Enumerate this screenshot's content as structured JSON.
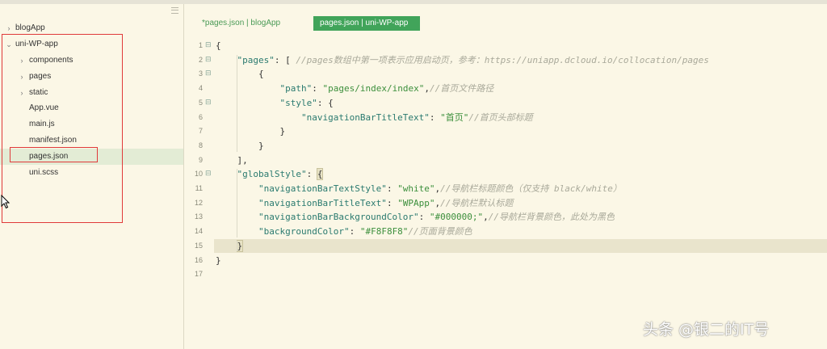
{
  "sidebar": {
    "items": [
      {
        "label": "blogApp",
        "arrow": "›"
      },
      {
        "label": "uni-WP-app",
        "arrow": "⌄"
      },
      {
        "label": "components",
        "arrow": "›"
      },
      {
        "label": "pages",
        "arrow": "›"
      },
      {
        "label": "static",
        "arrow": "›"
      },
      {
        "label": "App.vue",
        "arrow": ""
      },
      {
        "label": "main.js",
        "arrow": ""
      },
      {
        "label": "manifest.json",
        "arrow": ""
      },
      {
        "label": "pages.json",
        "arrow": ""
      },
      {
        "label": "uni.scss",
        "arrow": ""
      }
    ]
  },
  "tabs": [
    {
      "label": "*pages.json | blogApp"
    },
    {
      "label": "pages.json | uni-WP-app"
    }
  ],
  "editor": {
    "line_numbers": [
      "1",
      "2",
      "3",
      "4",
      "5",
      "6",
      "7",
      "8",
      "9",
      "10",
      "11",
      "12",
      "13",
      "14",
      "15",
      "16",
      "17"
    ],
    "folds": [
      "⊟",
      "⊟",
      "⊟",
      "",
      "⊟",
      "",
      "",
      "",
      "",
      "⊟",
      "",
      "",
      "",
      "",
      "",
      "",
      ""
    ],
    "lines": [
      [
        {
          "t": "p",
          "v": "{"
        }
      ],
      [
        {
          "t": "p",
          "v": "    "
        },
        {
          "t": "k",
          "v": "\"pages\""
        },
        {
          "t": "p",
          "v": ": [ "
        },
        {
          "t": "c",
          "v": "//pages数组中第一项表示应用启动页，参考：https://uniapp.dcloud.io/collocation/pages"
        }
      ],
      [
        {
          "t": "p",
          "v": "        {"
        }
      ],
      [
        {
          "t": "p",
          "v": "            "
        },
        {
          "t": "k",
          "v": "\"path\""
        },
        {
          "t": "p",
          "v": ": "
        },
        {
          "t": "s",
          "v": "\"pages/index/index\""
        },
        {
          "t": "p",
          "v": ","
        },
        {
          "t": "c",
          "v": "//首页文件路径"
        }
      ],
      [
        {
          "t": "p",
          "v": "            "
        },
        {
          "t": "k",
          "v": "\"style\""
        },
        {
          "t": "p",
          "v": ": {"
        }
      ],
      [
        {
          "t": "p",
          "v": "                "
        },
        {
          "t": "k",
          "v": "\"navigationBarTitleText\""
        },
        {
          "t": "p",
          "v": ": "
        },
        {
          "t": "s",
          "v": "\"首页\""
        },
        {
          "t": "c",
          "v": "//首页头部标题"
        }
      ],
      [
        {
          "t": "p",
          "v": "            }"
        }
      ],
      [
        {
          "t": "p",
          "v": "        }"
        }
      ],
      [
        {
          "t": "p",
          "v": "    ],"
        }
      ],
      [
        {
          "t": "p",
          "v": "    "
        },
        {
          "t": "k",
          "v": "\"globalStyle\""
        },
        {
          "t": "p",
          "v": ": "
        },
        {
          "t": "b",
          "v": "{"
        }
      ],
      [
        {
          "t": "p",
          "v": "        "
        },
        {
          "t": "k",
          "v": "\"navigationBarTextStyle\""
        },
        {
          "t": "p",
          "v": ": "
        },
        {
          "t": "s",
          "v": "\"white\""
        },
        {
          "t": "p",
          "v": ","
        },
        {
          "t": "c",
          "v": "//导航栏标题颜色（仅支持 black/white）"
        }
      ],
      [
        {
          "t": "p",
          "v": "        "
        },
        {
          "t": "k",
          "v": "\"navigationBarTitleText\""
        },
        {
          "t": "p",
          "v": ": "
        },
        {
          "t": "s",
          "v": "\"WPApp\""
        },
        {
          "t": "p",
          "v": ","
        },
        {
          "t": "c",
          "v": "//导航栏默认标题"
        }
      ],
      [
        {
          "t": "p",
          "v": "        "
        },
        {
          "t": "k",
          "v": "\"navigationBarBackgroundColor\""
        },
        {
          "t": "p",
          "v": ": "
        },
        {
          "t": "s",
          "v": "\"#000000;\""
        },
        {
          "t": "p",
          "v": ","
        },
        {
          "t": "c",
          "v": "//导航栏背景颜色，此处为黑色"
        }
      ],
      [
        {
          "t": "p",
          "v": "        "
        },
        {
          "t": "k",
          "v": "\"backgroundColor\""
        },
        {
          "t": "p",
          "v": ": "
        },
        {
          "t": "s",
          "v": "\"#F8F8F8\""
        },
        {
          "t": "c",
          "v": "//页面背景颜色"
        }
      ],
      [
        {
          "t": "p",
          "v": "    "
        },
        {
          "t": "b",
          "v": "}"
        }
      ],
      [
        {
          "t": "p",
          "v": "}"
        }
      ],
      [
        {
          "t": "p",
          "v": ""
        }
      ]
    ]
  },
  "watermark": "头条 @银二的IT号"
}
